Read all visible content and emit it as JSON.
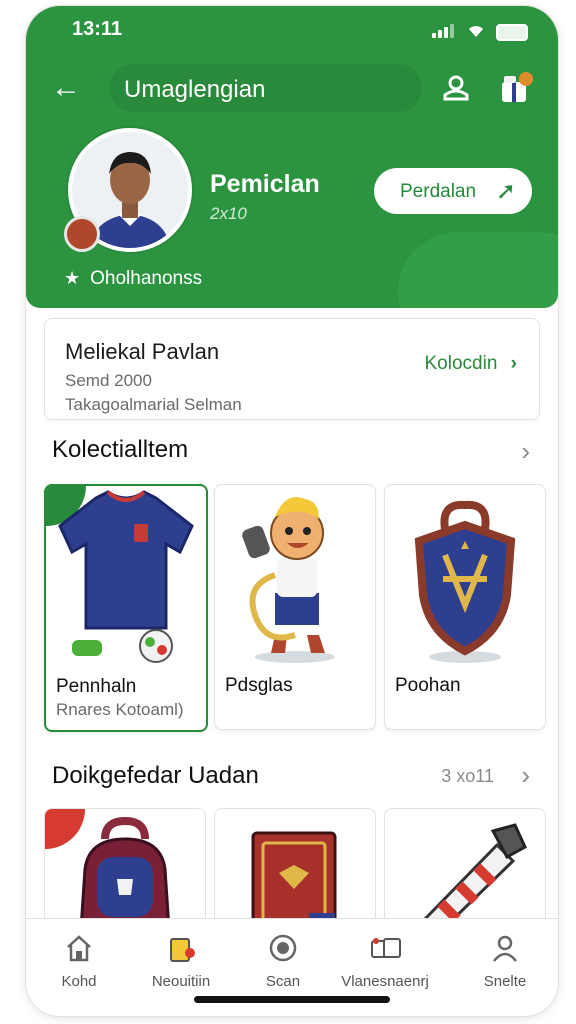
{
  "status": {
    "time": "13:11"
  },
  "header": {
    "title": "Umaglengian",
    "profile_name": "Pemiclan",
    "profile_sub": "2x10",
    "profile_button": "Perdalan",
    "stat_text": "Oholhanonss"
  },
  "summary": {
    "title": "Meliekal Pavlan",
    "line1": "Semd 2000",
    "line2": "Takagoalmarial Selman",
    "link": "Kolocdin"
  },
  "collection": {
    "title": "Kolectialltem",
    "items": [
      {
        "label": "Pennhaln",
        "sub": "Rnares Kotoaml)"
      },
      {
        "label": "Pdsglas",
        "sub": ""
      },
      {
        "label": "Poohan",
        "sub": ""
      }
    ]
  },
  "section2": {
    "title": "Doikgefedar Uadan",
    "count": "3 xo11"
  },
  "bottom_nav": [
    {
      "label": "Kohd",
      "icon": "home-icon"
    },
    {
      "label": "Neouitiin",
      "icon": "notebook-icon"
    },
    {
      "label": "Scan",
      "icon": "scan-icon"
    },
    {
      "label": "Vlanesnaenrj",
      "icon": "cards-icon"
    },
    {
      "label": "Snelte",
      "icon": "profile-icon"
    }
  ],
  "colors": {
    "brand_green": "#2c9440",
    "accent_red": "#d63b32",
    "navy": "#2f3f8f"
  }
}
